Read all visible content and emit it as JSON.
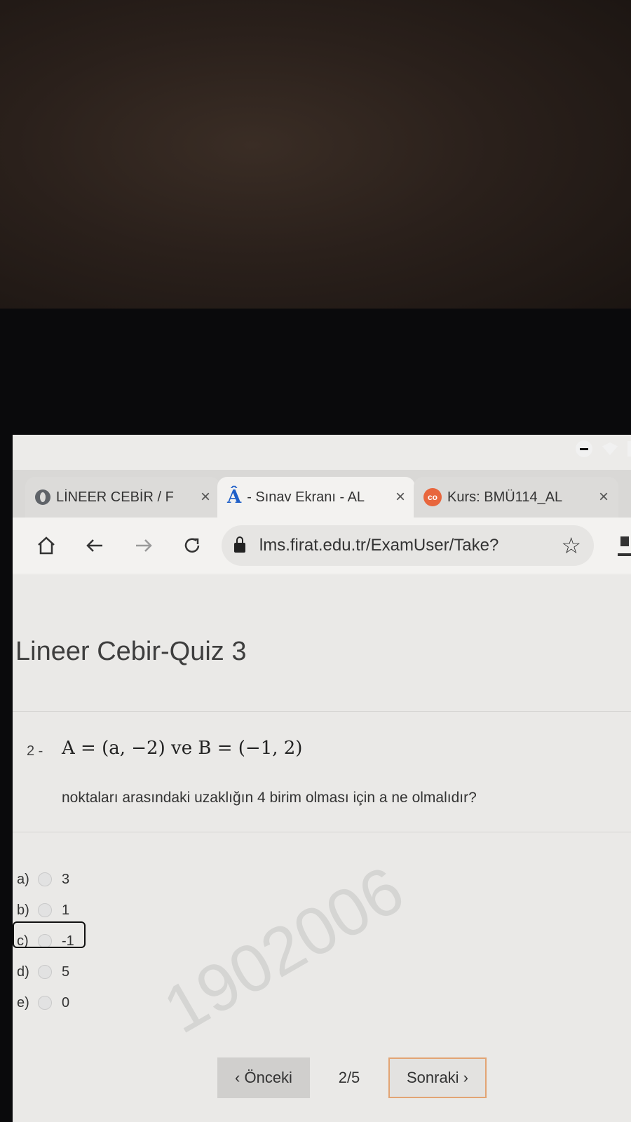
{
  "tabs": [
    {
      "title": "LİNEER CEBİR / F",
      "icon": "globe-icon"
    },
    {
      "title": "- Sınav Ekranı - AL",
      "icon": "a-logo-icon"
    },
    {
      "title": "Kurs: BMÜ114_AL",
      "icon": "cc-logo-icon"
    }
  ],
  "tab_close_label": "×",
  "browser": {
    "url": "lms.firat.edu.tr/ExamUser/Take?"
  },
  "quiz": {
    "title": "Lineer Cebir-Quiz 3",
    "question_number": "2 -",
    "question_formula": "A = (a, −2) ve B = (−1, 2)",
    "question_text": "noktaları arasındaki uzaklığın 4 birim olması için a ne olmalıdır?",
    "options": [
      {
        "letter": "a)",
        "value": "3"
      },
      {
        "letter": "b)",
        "value": "1"
      },
      {
        "letter": "c)",
        "value": "-1"
      },
      {
        "letter": "d)",
        "value": "5"
      },
      {
        "letter": "e)",
        "value": "0"
      }
    ],
    "watermark": "1902006"
  },
  "pager": {
    "prev_label": "‹ Önceki",
    "count": "2/5",
    "next_label": "Sonraki ›"
  },
  "colors": {
    "next_border": "#e2a474",
    "tab_active": "#f3f2f0"
  }
}
